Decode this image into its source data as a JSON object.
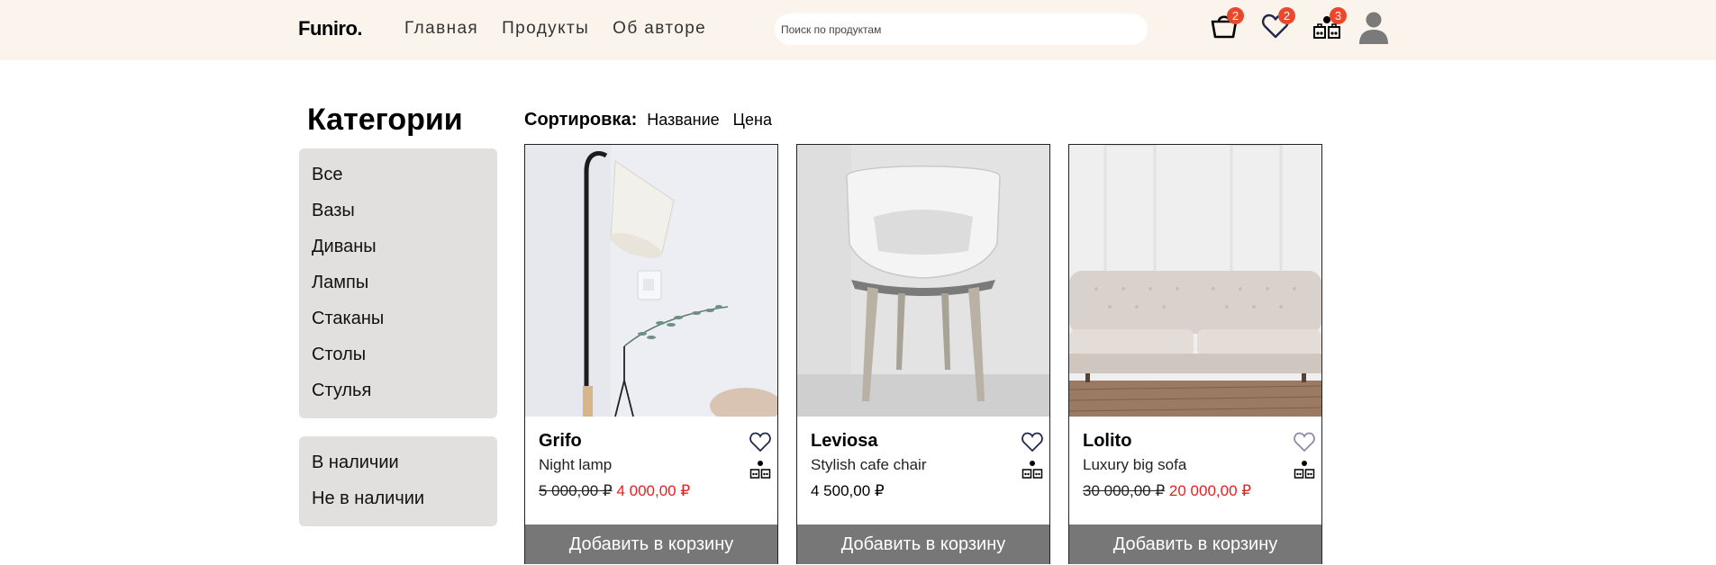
{
  "header": {
    "logo": "Funiro.",
    "nav": [
      "Главная",
      "Продукты",
      "Об авторе"
    ],
    "search_placeholder": "Поиск по продуктам",
    "cart_count": "2",
    "favorites_count": "2",
    "compare_count": "3",
    "badge_color": "#e9482c",
    "background": "#fbf4ec"
  },
  "sidebar": {
    "title": "Категории",
    "categories": [
      "Все",
      "Вазы",
      "Диваны",
      "Лампы",
      "Стаканы",
      "Столы",
      "Стулья"
    ],
    "availability": [
      "В наличии",
      "Не в наличии"
    ]
  },
  "sort": {
    "label": "Сортировка:",
    "options": [
      "Название",
      "Цена"
    ]
  },
  "products": [
    {
      "name": "Grifo",
      "desc": "Night lamp",
      "old_price": "5 000,00 ₽",
      "price": "4 000,00 ₽",
      "button": "Добавить в корзину",
      "icon": "floor-lamp-photo"
    },
    {
      "name": "Leviosa",
      "desc": "Stylish cafe chair",
      "old_price": "",
      "price": "4 500,00 ₽",
      "button": "Добавить в корзину",
      "icon": "chair-photo"
    },
    {
      "name": "Lolito",
      "desc": "Luxury big sofa",
      "old_price": "30 000,00 ₽",
      "price": "20 000,00 ₽",
      "button": "Добавить в корзину",
      "icon": "sofa-photo"
    }
  ],
  "colors": {
    "sale_price": "#e52020",
    "button": "#777777",
    "sidebar_box": "#e1e0df"
  }
}
